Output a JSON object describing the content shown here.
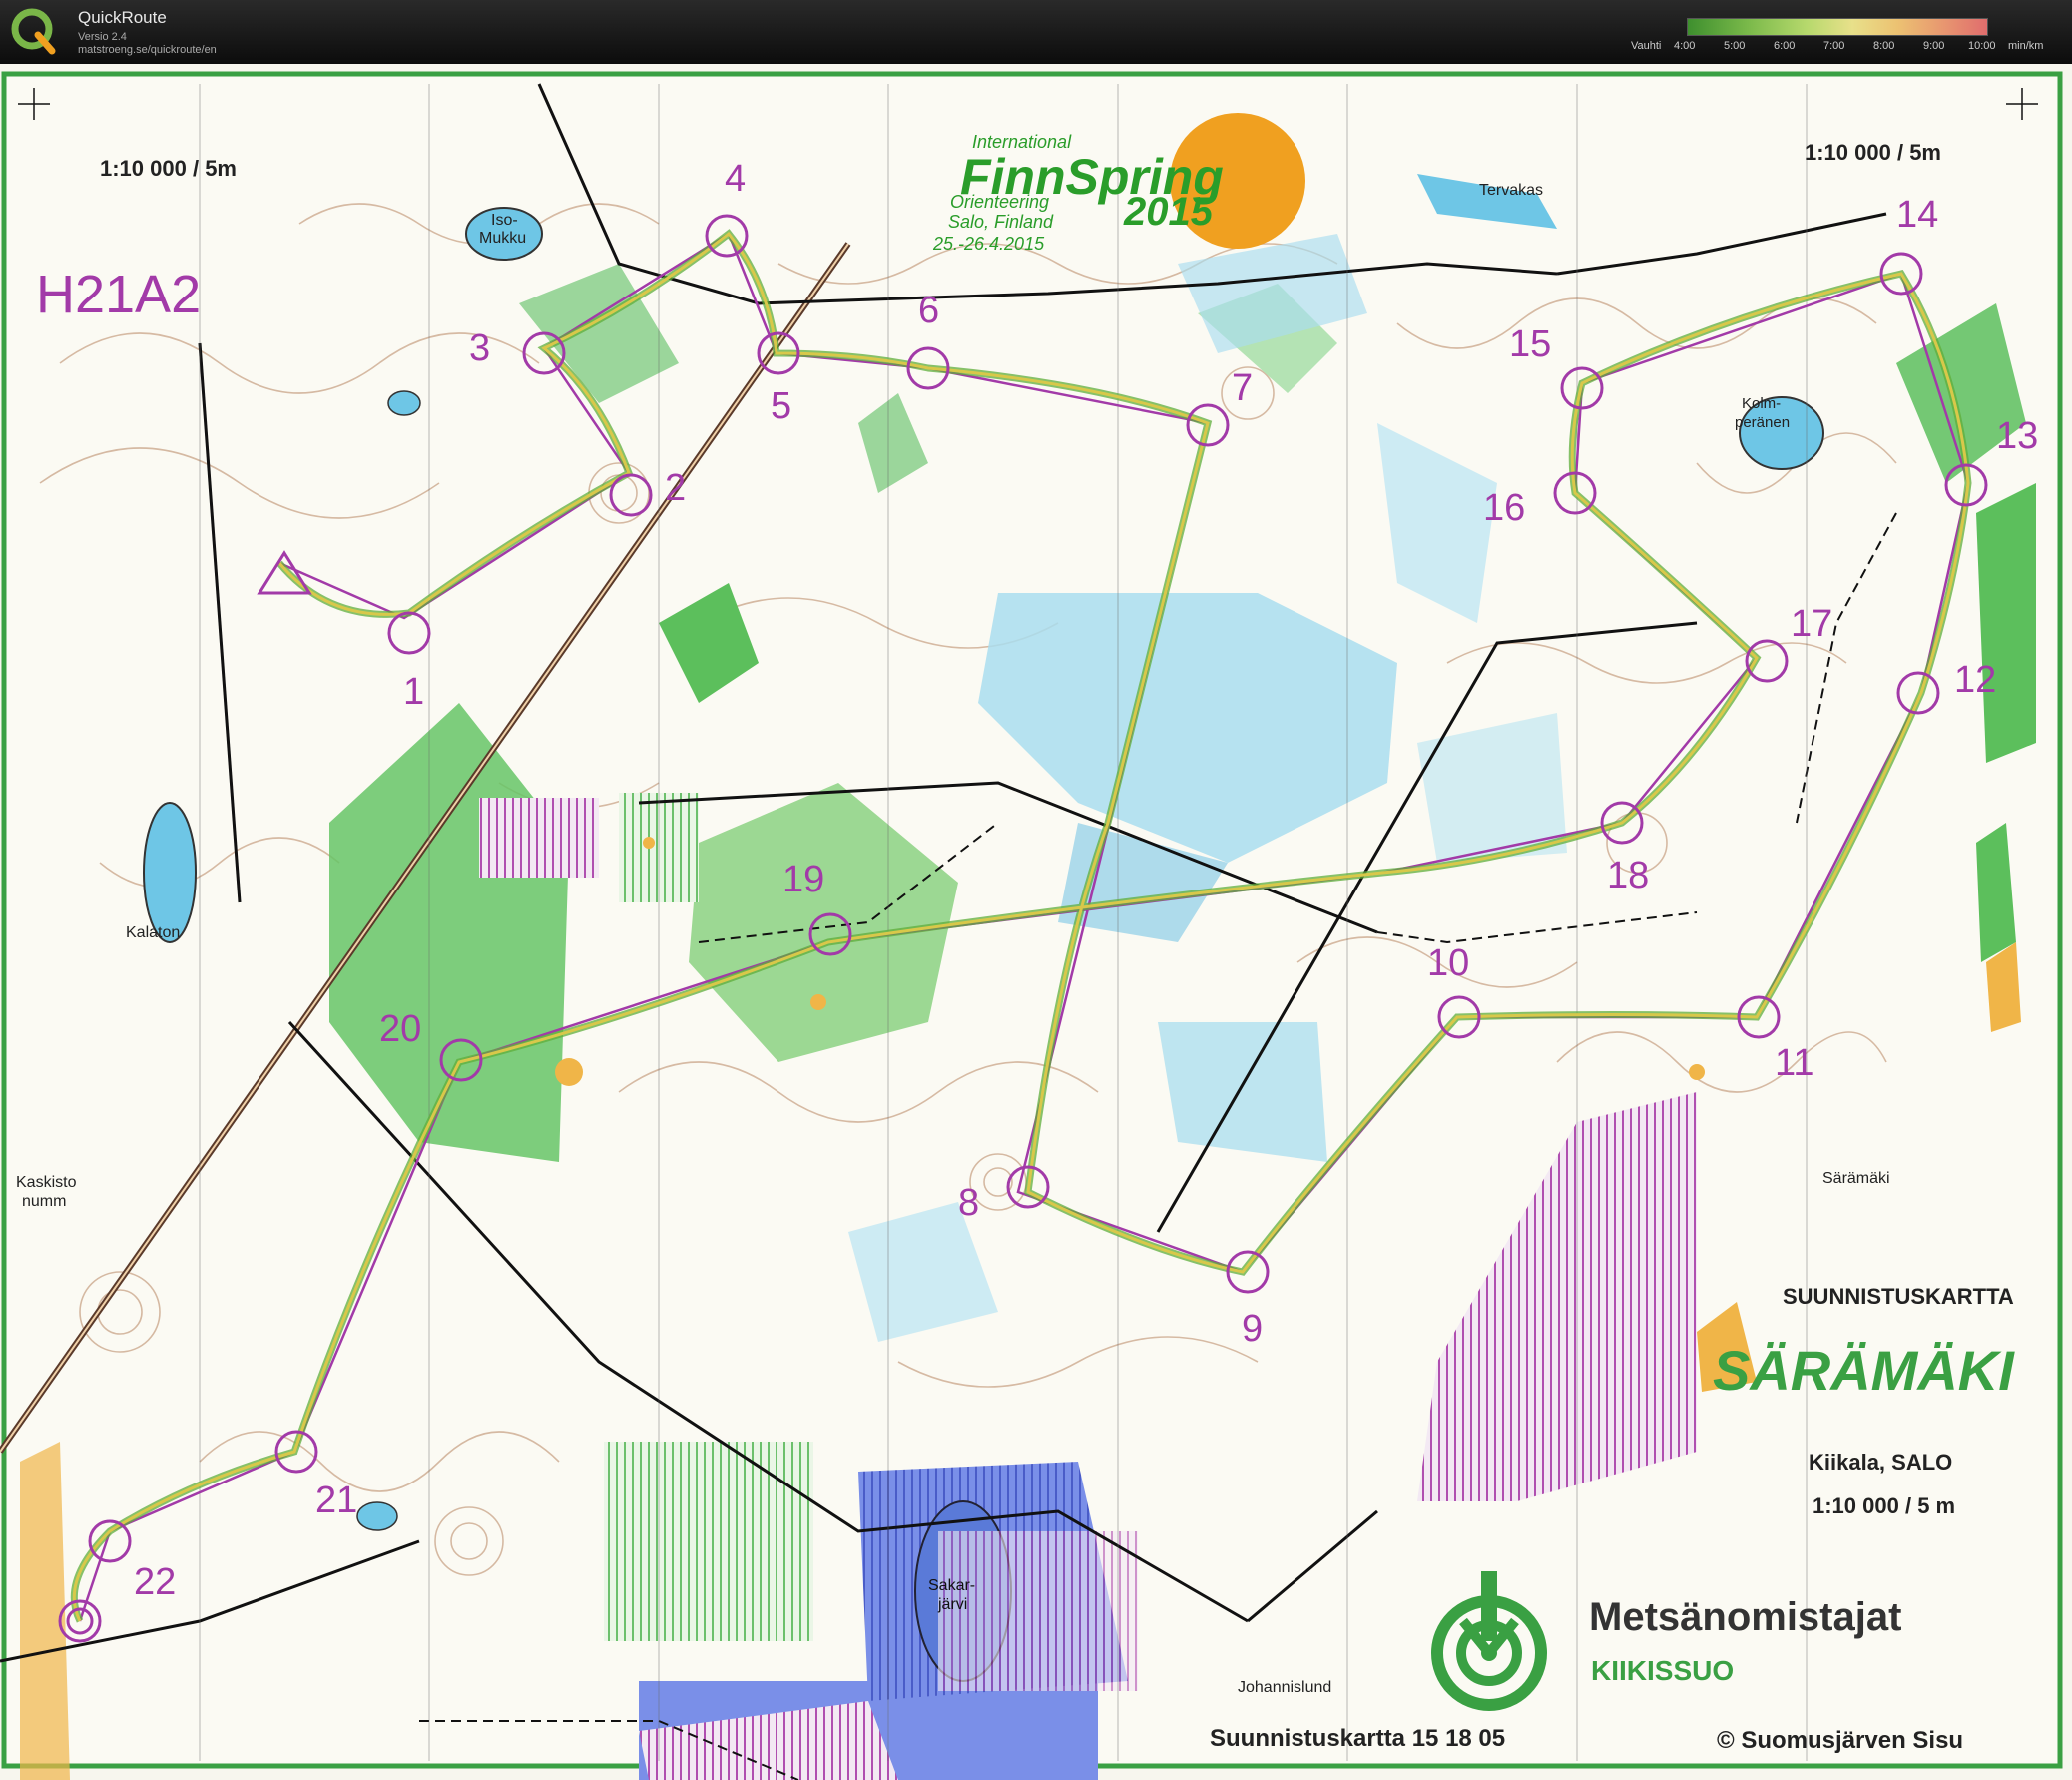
{
  "app": {
    "title": "QuickRoute",
    "version": "Versio 2.4",
    "url": "matstroeng.se/quickroute/en",
    "logo_icon": "quickroute-logo-icon"
  },
  "pace_legend": {
    "label": "Vauhti",
    "ticks": [
      "4:00",
      "5:00",
      "6:00",
      "7:00",
      "8:00",
      "9:00",
      "10:00"
    ],
    "unit": "min/km"
  },
  "map": {
    "course": "H21A2",
    "scale_left": "1:10 000 / 5m",
    "scale_right": "1:10 000 / 5m",
    "event_logo": {
      "line1": "International",
      "brand": "FinnSpring",
      "sub1": "Orienteering",
      "sub2": "Salo, Finland",
      "dates": "25.-26.4.2015",
      "year": "2015"
    },
    "place_names": {
      "iso_mukku_1": "Iso-",
      "iso_mukku_2": "Mukku",
      "tervakas": "Tervakas",
      "kolmperanen_1": "Kolm-",
      "kolmperanen_2": "peränen",
      "kalaton": "Kalaton",
      "kaskisto_1": "Kaskisto",
      "kaskisto_2": "numm",
      "saramaki_small": "Särämäki",
      "sakarjarvi_1": "Sakar-",
      "sakarjarvi_2": "järvi",
      "johannislund": "Johannislund"
    },
    "info_block": {
      "heading": "SUUNNISTUSKARTTA",
      "map_name": "SÄRÄMÄKI",
      "location": "Kiikala, SALO",
      "scale": "1:10 000 / 5 m",
      "sponsor": "Metsänomistajat",
      "sponsor_sub": "KIIKISSUO",
      "map_number": "Suunnistuskartta 15 18 05",
      "copyright": "© Suomusjärven Sisu"
    },
    "controls": [
      "1",
      "2",
      "3",
      "4",
      "5",
      "6",
      "7",
      "8",
      "9",
      "10",
      "11",
      "12",
      "13",
      "14",
      "15",
      "16",
      "17",
      "18",
      "19",
      "20",
      "21",
      "22"
    ],
    "colors": {
      "course_purple": "#a23aa8",
      "route_yellow": "#d8c84a",
      "route_green": "#5fae3b",
      "water_blue": "#6ec6e6",
      "forest_green": "#5cbf5c",
      "logo_orange": "#f0a020"
    }
  }
}
